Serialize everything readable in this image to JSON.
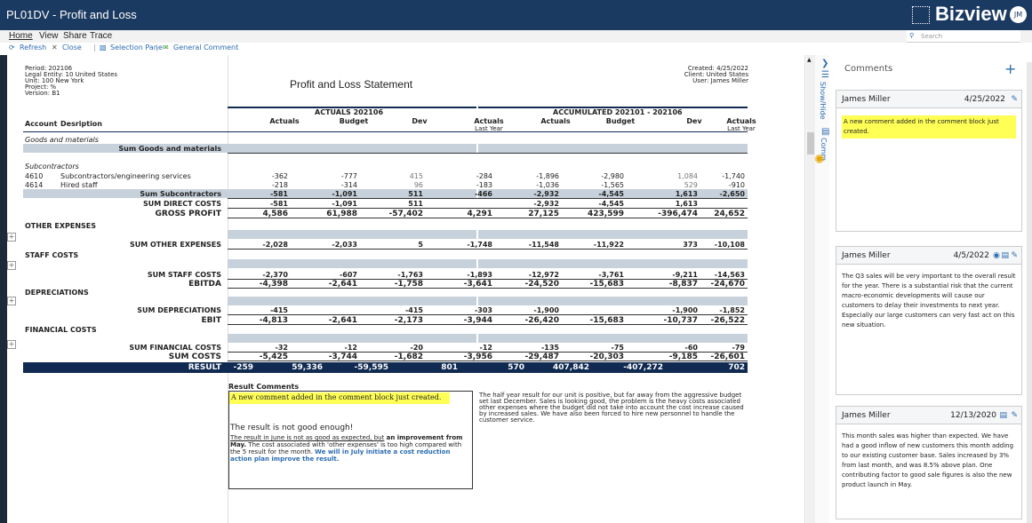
{
  "app": {
    "title": "PL01DV - Profit and Loss",
    "logo": "Bizview",
    "avatar": "JM"
  },
  "menu": [
    "Home",
    "View",
    "Share",
    "Trace"
  ],
  "search": {
    "placeholder": "Search"
  },
  "toolbar": [
    "Refresh",
    "Close",
    "Selection Pane",
    "General Comment"
  ],
  "meta_left": [
    "Period: 202106",
    "Legal Entity: 10 United States",
    "Unit: 100 New York",
    "Project: %",
    "Version: B1"
  ],
  "meta_right": [
    "Created: 4/25/2022",
    "Client: United States",
    "User: James Miller"
  ],
  "report_title": "Profit and Loss Statement",
  "headers": {
    "actuals_group": "ACTUALS 202106",
    "accum_group": "ACCUMULATED 202101 - 202106",
    "account": "Account",
    "desc": "Desription",
    "cols": [
      "Actuals",
      "Budget",
      "Dev",
      "Actuals Last Year",
      "Actuals",
      "Budget",
      "Dev",
      "Actuals Last Year"
    ]
  },
  "rows": [
    {
      "label": "Goods and materials",
      "style": "italic",
      "vals": []
    },
    {
      "label": "Sum Goods and materials",
      "style": "sum",
      "vals": []
    },
    {
      "label": "Subcontractors",
      "style": "italic",
      "vals": []
    },
    {
      "acc": "4610",
      "label": "Subcontractors/engineering services",
      "style": "plain",
      "vals": [
        "-362",
        "-777",
        "415",
        "-284",
        "-1,896",
        "-2,980",
        "1,084",
        "-1,740"
      ]
    },
    {
      "acc": "4614",
      "label": "Hired staff",
      "style": "plain",
      "vals": [
        "-218",
        "-314",
        "96",
        "-183",
        "-1,036",
        "-1,565",
        "529",
        "-910"
      ]
    },
    {
      "label": "Sum Subcontractors",
      "style": "sum",
      "vals": [
        "-581",
        "-1,091",
        "511",
        "-466",
        "-2,932",
        "-4,545",
        "1,613",
        "-2,650"
      ]
    },
    {
      "label": "SUM DIRECT COSTS",
      "style": "bold",
      "vals": [
        "-581",
        "-1,091",
        "511",
        "",
        "-2,932",
        "-4,545",
        "1,613",
        ""
      ]
    },
    {
      "label": "GROSS PROFIT",
      "style": "big",
      "vals": [
        "4,586",
        "61,988",
        "-57,402",
        "4,291",
        "27,125",
        "423,599",
        "-396,474",
        "24,652"
      ]
    },
    {
      "label": "OTHER EXPENSES",
      "style": "section",
      "vals": []
    },
    {
      "label": "SUM OTHER EXPENSES",
      "style": "bold",
      "vals": [
        "-2,028",
        "-2,033",
        "5",
        "-1,748",
        "-11,548",
        "-11,922",
        "373",
        "-10,108"
      ]
    },
    {
      "label": "STAFF COSTS",
      "style": "section",
      "vals": []
    },
    {
      "label": "SUM STAFF COSTS",
      "style": "bold",
      "vals": [
        "-2,370",
        "-607",
        "-1,763",
        "-1,893",
        "-12,972",
        "-3,761",
        "-9,211",
        "-14,563"
      ]
    },
    {
      "label": "EBITDA",
      "style": "big",
      "vals": [
        "-4,398",
        "-2,641",
        "-1,758",
        "-3,641",
        "-24,520",
        "-15,683",
        "-8,837",
        "-24,670"
      ]
    },
    {
      "label": "DEPRECIATIONS",
      "style": "section",
      "vals": []
    },
    {
      "label": "SUM DEPRECIATIONS",
      "style": "bold",
      "vals": [
        "-415",
        "",
        "-415",
        "-303",
        "-1,900",
        "",
        "-1,900",
        "-1,852"
      ]
    },
    {
      "label": "EBIT",
      "style": "big",
      "vals": [
        "-4,813",
        "-2,641",
        "-2,173",
        "-3,944",
        "-26,420",
        "-15,683",
        "-10,737",
        "-26,522"
      ]
    },
    {
      "label": "FINANCIAL COSTS",
      "style": "section",
      "vals": []
    },
    {
      "label": "SUM FINANCIAL COSTS",
      "style": "bold",
      "vals": [
        "-32",
        "-12",
        "-20",
        "-12",
        "-135",
        "-75",
        "-60",
        "-79"
      ]
    },
    {
      "label": "SUM COSTS",
      "style": "big",
      "vals": [
        "-5,425",
        "-3,744",
        "-1,682",
        "-3,956",
        "-29,487",
        "-20,303",
        "-9,185",
        "-26,601"
      ]
    }
  ],
  "result_row": {
    "label": "RESULT",
    "vals": [
      "-259",
      "59,336",
      "-59,595",
      "801",
      "570",
      "407,842",
      "-407,272",
      "702"
    ]
  },
  "result_comments": {
    "heading": "Result Comments",
    "highlight": "A new comment added in the comment block just created.",
    "line1": "The result is not good enough!",
    "p1": "The result in June is not as good as expected, but",
    "p1b": "an improvement from May.",
    "p2": "The cost associated with 'other expenses' is too high compared with the 5 result for the month.",
    "p3": "We will in July initiate a cost reduction action plan improve the result."
  },
  "side_text": "The half year result for our unit is positive, but far away from the aggressive budget set last December. Sales is looking good, the problem is the heavy costs associated other expenses where the budget did not take into account the cost increase caused by increased sales. We have also been forced to hire new personnel to handle the customer service.",
  "sidebar": {
    "show_hide": "Show/Hide",
    "comm": "Comm"
  },
  "comments": {
    "title": "Comments",
    "add": "+",
    "items": [
      {
        "author": "James Miller",
        "date": "4/25/2022",
        "text": "A new comment added in the comment block just created."
      },
      {
        "author": "James Miller",
        "date": "4/5/2022",
        "text": "The Q3 sales will be very important to the overall result for the year. There is a substantial risk that the current macro-economic developments will cause our customers to delay their investments to next year. Especially our large customers can very fast act on this new situation."
      },
      {
        "author": "James Miller",
        "date": "12/13/2020",
        "text": "This month sales was higher than expected. We have had a good inflow of new customers this month adding to our existing customer base. Sales increased by 3% from last month, and was 8.5% above plan. One contributing factor to good sale figures is also the new product launch in May."
      }
    ]
  },
  "colors": {
    "titlebar": "#1b3a61",
    "result": "#102a51",
    "band": "#c7d1db",
    "highlight": "#ffff55",
    "link": "#2b6cb0"
  }
}
